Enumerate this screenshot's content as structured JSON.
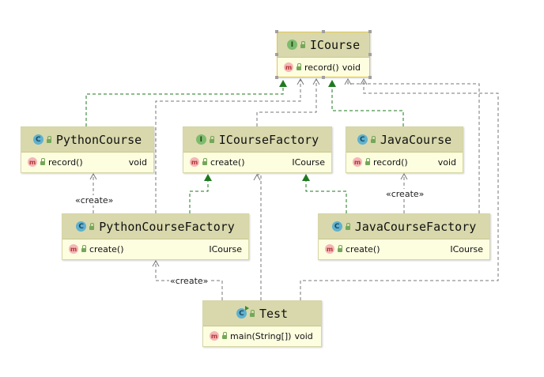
{
  "diagram": {
    "classes": [
      {
        "id": "icourse",
        "kind": "interface",
        "kind_glyph": "I",
        "name": "ICourse",
        "methods": [
          {
            "name": "record()",
            "ret": "void"
          }
        ]
      },
      {
        "id": "pythoncourse",
        "kind": "class",
        "kind_glyph": "C",
        "name": "PythonCourse",
        "methods": [
          {
            "name": "record()",
            "ret": "void"
          }
        ]
      },
      {
        "id": "icoursefactory",
        "kind": "interface",
        "kind_glyph": "I",
        "name": "ICourseFactory",
        "methods": [
          {
            "name": "create()",
            "ret": "ICourse"
          }
        ]
      },
      {
        "id": "javacourse",
        "kind": "class",
        "kind_glyph": "C",
        "name": "JavaCourse",
        "methods": [
          {
            "name": "record()",
            "ret": "void"
          }
        ]
      },
      {
        "id": "pythoncoursefactory",
        "kind": "class",
        "kind_glyph": "C",
        "name": "PythonCourseFactory",
        "methods": [
          {
            "name": "create()",
            "ret": "ICourse"
          }
        ]
      },
      {
        "id": "javacoursefactory",
        "kind": "class",
        "kind_glyph": "C",
        "name": "JavaCourseFactory",
        "methods": [
          {
            "name": "create()",
            "ret": "ICourse"
          }
        ]
      },
      {
        "id": "test",
        "kind": "main",
        "kind_glyph": "C",
        "name": "Test",
        "methods": [
          {
            "name": "main(String[])",
            "ret": "void"
          }
        ]
      }
    ],
    "method_badge": "m",
    "stereotypes": {
      "create_python": "«create»",
      "create_java": "«create»",
      "create_test": "«create»"
    },
    "colors": {
      "realization_arrow": "#1e7a1e",
      "dependency_line": "#666666",
      "class_header": "#d8d8ac",
      "class_body": "#fdfde0"
    }
  }
}
